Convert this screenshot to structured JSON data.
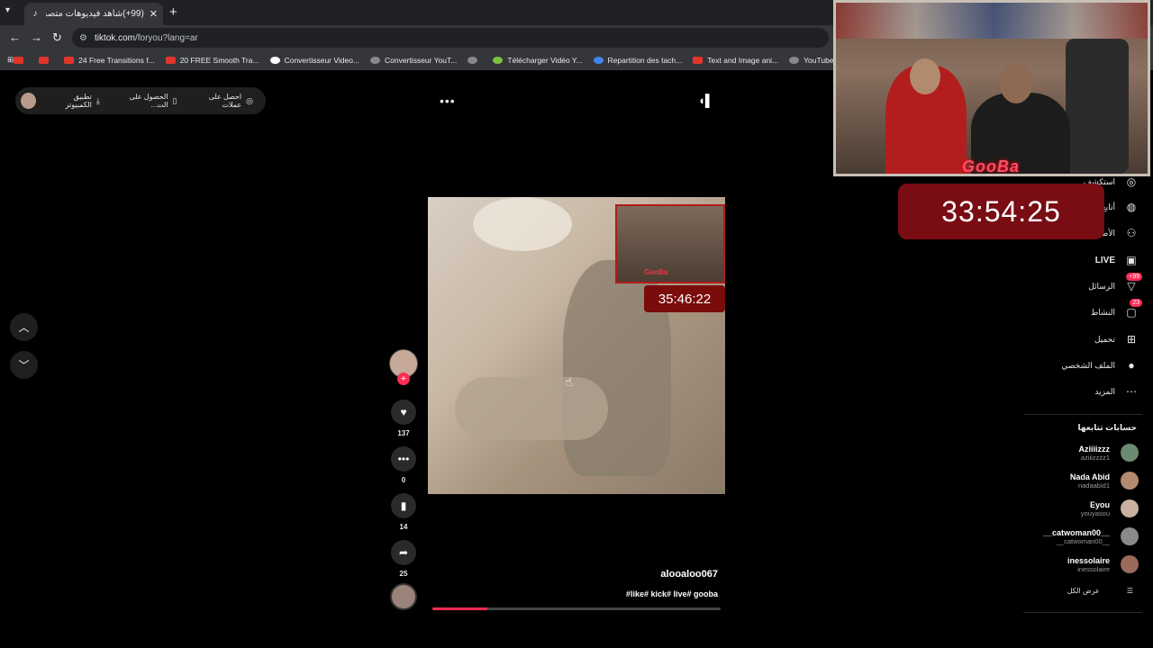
{
  "browser": {
    "tab_title": "(99+)شاهد فيديوهات متصدرة | 𝘬",
    "url_host": "tiktok.com",
    "url_path": "/foryou?lang=ar",
    "bookmarks": [
      {
        "label": "",
        "icon": "youtube"
      },
      {
        "label": "",
        "icon": "youtube"
      },
      {
        "label": "24 Free Transitions f...",
        "icon": "youtube"
      },
      {
        "label": "20 FREE Smooth Tra...",
        "icon": "youtube"
      },
      {
        "label": "Convertisseur Video...",
        "icon": "google"
      },
      {
        "label": "Convertisseur YouT...",
        "icon": "converter"
      },
      {
        "label": "",
        "icon": "globe"
      },
      {
        "label": "Télécharger Vidéo Y...",
        "icon": "download"
      },
      {
        "label": "Repartition des tach...",
        "icon": "docs"
      },
      {
        "label": "Text and Image ani...",
        "icon": "youtube"
      },
      {
        "label": "YouTube Converter...",
        "icon": "globe"
      }
    ]
  },
  "topbar": {
    "get_coins": "احصل على عملات",
    "get_app": "الحصول على الت...",
    "desktop_app": "تطبيق الكمبيوتر"
  },
  "video": {
    "overlay_timer": "35:46:22",
    "overlay_brand": "GooBa",
    "username": "alooaloo067",
    "hashtags": "like# kick# live# gooba#",
    "progress_fraction": 0.19
  },
  "actions": {
    "likes": "137",
    "comments": "0",
    "saves": "14",
    "shares": "25"
  },
  "sidebar": {
    "explore": "استكشف",
    "following": "أتابع",
    "friends": "الأصدقاء",
    "live": "LIVE",
    "messages": "الرسائل",
    "messages_badge": "99+",
    "activity": "النشاط",
    "activity_badge": "23",
    "upload": "تحميل",
    "profile": "الملف الشخصي",
    "more": "المزيد",
    "following_title": "حسابات تتابعها",
    "accounts": [
      {
        "name": "Aziiiizzz",
        "handle": "aziiizzzz1"
      },
      {
        "name": "Nada Abid",
        "handle": "nadaabid1"
      },
      {
        "name": "Eyou",
        "handle": "youyasou"
      },
      {
        "name": "__catwoman00__",
        "handle": "__catwoman00__"
      },
      {
        "name": "inessolaire",
        "handle": "inessolaire"
      }
    ],
    "see_all": "عرض الكل"
  },
  "stream": {
    "brand": "GooBa",
    "timer": "33:54:25"
  },
  "colors": {
    "accent": "#fe2c55",
    "timer_bg": "#7a0c14"
  }
}
